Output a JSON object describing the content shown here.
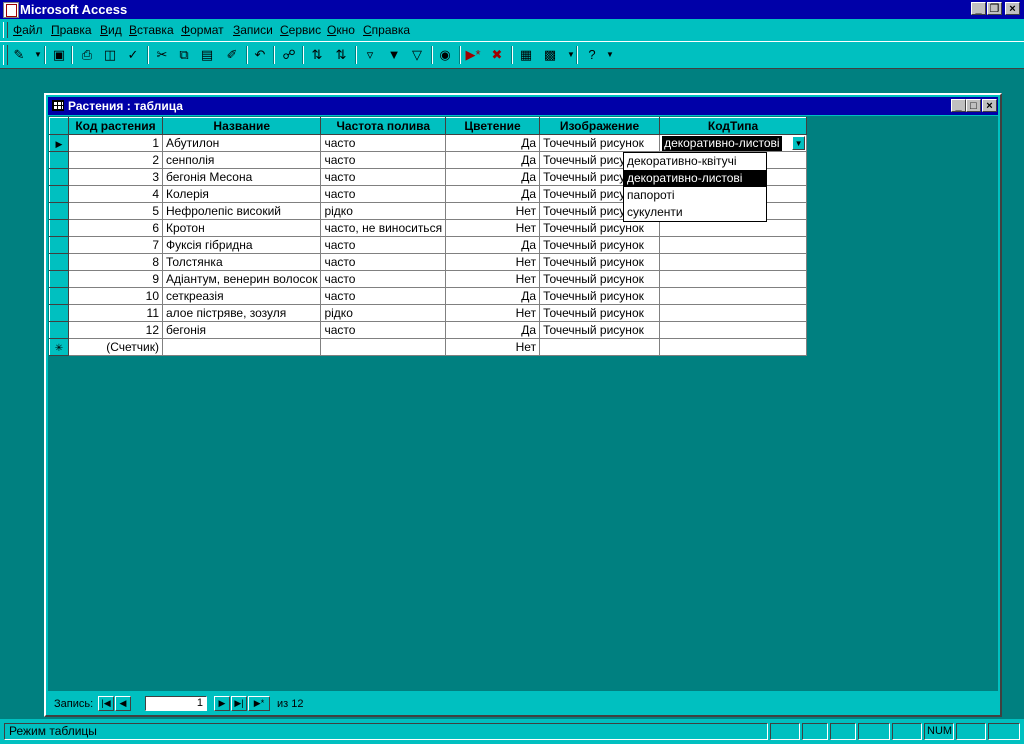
{
  "window": {
    "title": "Microsoft Access"
  },
  "menu": {
    "items": [
      {
        "label": "Файл"
      },
      {
        "label": "Правка"
      },
      {
        "label": "Вид"
      },
      {
        "label": "Вставка"
      },
      {
        "label": "Формат"
      },
      {
        "label": "Записи"
      },
      {
        "label": "Сервис"
      },
      {
        "label": "Окно"
      },
      {
        "label": "Справка"
      }
    ]
  },
  "toolbar": {
    "buttons": [
      {
        "name": "view-icon"
      },
      {
        "name": "save-icon"
      },
      {
        "name": "print-icon"
      },
      {
        "name": "print-preview-icon"
      },
      {
        "name": "spelling-icon"
      },
      {
        "name": "cut-icon"
      },
      {
        "name": "copy-icon"
      },
      {
        "name": "paste-icon"
      },
      {
        "name": "format-painter-icon"
      },
      {
        "name": "undo-icon"
      },
      {
        "name": "hyperlink-icon"
      },
      {
        "name": "sort-ascending-icon"
      },
      {
        "name": "sort-descending-icon"
      },
      {
        "name": "filter-by-selection-icon"
      },
      {
        "name": "filter-by-form-icon"
      },
      {
        "name": "apply-filter-icon"
      },
      {
        "name": "find-icon"
      },
      {
        "name": "new-record-icon"
      },
      {
        "name": "delete-record-icon"
      },
      {
        "name": "database-window-icon"
      },
      {
        "name": "new-object-icon"
      },
      {
        "name": "help-icon"
      }
    ]
  },
  "table_window": {
    "title": "Растения : таблица",
    "columns": [
      "Код растения",
      "Название",
      "Частота полива",
      "Цветение",
      "Изображение",
      "КодТипа"
    ],
    "rows": [
      {
        "id": "1",
        "name": "Абутилон",
        "freq": "часто",
        "bloom": "Да",
        "image": "Точечный рисунок",
        "type": "декоративно-листові"
      },
      {
        "id": "2",
        "name": "сенполія",
        "freq": "часто",
        "bloom": "Да",
        "image": "Точечный рисунок",
        "type": ""
      },
      {
        "id": "3",
        "name": "бегонія Месона",
        "freq": "часто",
        "bloom": "Да",
        "image": "Точечный рисунок",
        "type": ""
      },
      {
        "id": "4",
        "name": "Колерія",
        "freq": "часто",
        "bloom": "Да",
        "image": "Точечный рисунок",
        "type": ""
      },
      {
        "id": "5",
        "name": "Нефролепіс високий",
        "freq": "рідко",
        "bloom": "Нет",
        "image": "Точечный рисунок",
        "type": ""
      },
      {
        "id": "6",
        "name": "Кротон",
        "freq": "часто, не виноситься",
        "bloom": "Нет",
        "image": "Точечный рисунок",
        "type": ""
      },
      {
        "id": "7",
        "name": "Фуксія гібридна",
        "freq": "часто",
        "bloom": "Да",
        "image": "Точечный рисунок",
        "type": ""
      },
      {
        "id": "8",
        "name": "Толстянка",
        "freq": "часто",
        "bloom": "Нет",
        "image": "Точечный рисунок",
        "type": ""
      },
      {
        "id": "9",
        "name": "Адіантум, венерин волосок",
        "freq": "часто",
        "bloom": "Нет",
        "image": "Точечный рисунок",
        "type": ""
      },
      {
        "id": "10",
        "name": "сеткреазія",
        "freq": "часто",
        "bloom": "Да",
        "image": "Точечный рисунок",
        "type": ""
      },
      {
        "id": "11",
        "name": "алое пістряве, зозуля",
        "freq": "рідко",
        "bloom": "Нет",
        "image": "Точечный рисунок",
        "type": ""
      },
      {
        "id": "12",
        "name": "бегонія",
        "freq": "часто",
        "bloom": "Да",
        "image": "Точечный рисунок",
        "type": ""
      }
    ],
    "new_row": {
      "id": "(Счетчик)",
      "bloom": "Нет"
    },
    "dropdown_options": [
      "декоративно-квітучі",
      "декоративно-листові",
      "папороті",
      "сукуленти"
    ],
    "dropdown_selected_index": 1,
    "nav": {
      "label": "Запись:",
      "current": "1",
      "of_text": "из 12"
    }
  },
  "status": {
    "text": "Режим таблицы",
    "num": "NUM"
  }
}
